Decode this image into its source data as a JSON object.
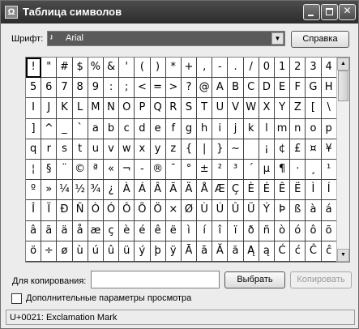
{
  "window": {
    "title": "Таблица символов",
    "icon_glyph": "Ω",
    "buttons": {
      "minimize": "",
      "maximize": "",
      "close": "✕"
    }
  },
  "font": {
    "label": "Шрифт:",
    "selected": "Arial",
    "truetype_glyph": "ʇ",
    "help_button": "Справка"
  },
  "grid": {
    "selected_index": 0,
    "rows": [
      [
        "!",
        "\"",
        "#",
        "$",
        "%",
        "&",
        "'",
        "(",
        ")",
        "*",
        "+",
        ",",
        "-",
        ".",
        "/",
        "0",
        "1",
        "2",
        "3",
        "4"
      ],
      [
        "5",
        "6",
        "7",
        "8",
        "9",
        ":",
        ";",
        "<",
        "=",
        ">",
        "?",
        "@",
        "A",
        "B",
        "C",
        "D",
        "E",
        "F",
        "G",
        "H"
      ],
      [
        "I",
        "J",
        "K",
        "L",
        "M",
        "N",
        "O",
        "P",
        "Q",
        "R",
        "S",
        "T",
        "U",
        "V",
        "W",
        "X",
        "Y",
        "Z",
        "[",
        "\\"
      ],
      [
        "]",
        "^",
        "_",
        "`",
        "a",
        "b",
        "c",
        "d",
        "e",
        "f",
        "g",
        "h",
        "i",
        "j",
        "k",
        "l",
        "m",
        "n",
        "o",
        "p"
      ],
      [
        "q",
        "r",
        "s",
        "t",
        "u",
        "v",
        "w",
        "x",
        "y",
        "z",
        "{",
        "|",
        "}",
        "~",
        " ",
        "¡",
        "¢",
        "£",
        "¤",
        "¥"
      ],
      [
        "¦",
        "§",
        "¨",
        "©",
        "ª",
        "«",
        "¬",
        "-",
        "®",
        "¯",
        "°",
        "±",
        "²",
        "³",
        "´",
        "µ",
        "¶",
        "·",
        "¸",
        "¹"
      ],
      [
        "º",
        "»",
        "¼",
        "½",
        "¾",
        "¿",
        "À",
        "Á",
        "Â",
        "Ã",
        "Ä",
        "Å",
        "Æ",
        "Ç",
        "È",
        "É",
        "Ê",
        "Ë",
        "Ì",
        "Í"
      ],
      [
        "Î",
        "Ï",
        "Ð",
        "Ñ",
        "Ò",
        "Ó",
        "Ô",
        "Õ",
        "Ö",
        "×",
        "Ø",
        "Ù",
        "Ú",
        "Û",
        "Ü",
        "Ý",
        "Þ",
        "ß",
        "à",
        "á"
      ],
      [
        "â",
        "ã",
        "ä",
        "å",
        "æ",
        "ç",
        "è",
        "é",
        "ê",
        "ë",
        "ì",
        "í",
        "î",
        "ï",
        "ð",
        "ñ",
        "ò",
        "ó",
        "ô",
        "õ"
      ],
      [
        "ö",
        "÷",
        "ø",
        "ù",
        "ú",
        "û",
        "ü",
        "ý",
        "þ",
        "ÿ",
        "Ā",
        "ā",
        "Ă",
        "ă",
        "Ą",
        "ą",
        "Ć",
        "ć",
        "Ĉ",
        "ĉ"
      ]
    ]
  },
  "scrollbar": {
    "up_glyph": "▲",
    "down_glyph": "▼"
  },
  "copy": {
    "label": "Для копирования:",
    "value": "",
    "select_button": "Выбрать",
    "copy_button": "Копировать"
  },
  "advanced": {
    "label": "Дополнительные параметры просмотра",
    "checked": false
  },
  "status": {
    "text": "U+0021: Exclamation Mark"
  }
}
